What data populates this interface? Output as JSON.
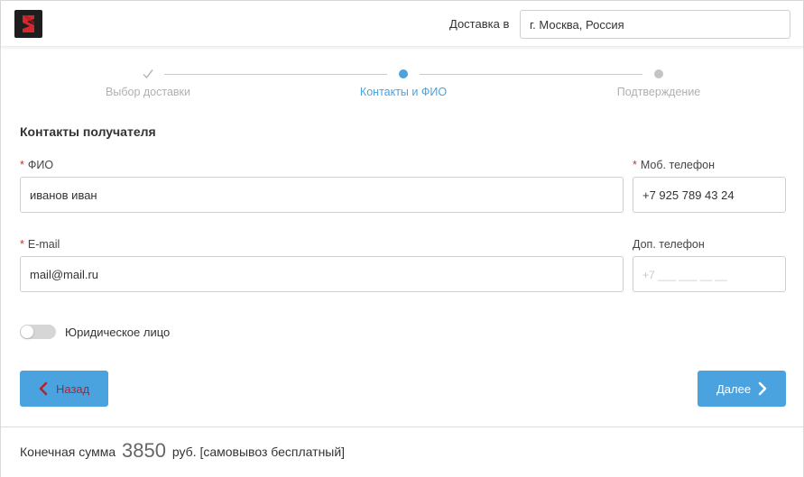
{
  "header": {
    "delivery_label": "Доставка в",
    "city_value": "г. Москва, Россия"
  },
  "steps": [
    {
      "label": "Выбор доставки",
      "state": "done"
    },
    {
      "label": "Контакты и ФИО",
      "state": "active"
    },
    {
      "label": "Подтверждение",
      "state": "pending"
    }
  ],
  "form": {
    "section_title": "Контакты получателя",
    "fio": {
      "label": "ФИО",
      "value": "иванов иван",
      "required": true
    },
    "mobile": {
      "label": "Моб. телефон",
      "value": "+7 925 789 43 24",
      "required": true
    },
    "email": {
      "label": "E-mail",
      "value": "mail@mail.ru",
      "required": true
    },
    "extra_phone": {
      "label": "Доп. телефон",
      "placeholder": "+7 ___ ___ __ __",
      "value": ""
    },
    "legal_entity": {
      "label": "Юридическое лицо",
      "checked": false
    }
  },
  "buttons": {
    "back_label": "Назад",
    "next_label": "Далее"
  },
  "footer": {
    "prefix": "Конечная сумма",
    "amount": "3850",
    "suffix": "руб. [самовывоз бесплатный]"
  },
  "colors": {
    "accent": "#4aa3df",
    "required": "#c0392b",
    "back_text": "#b4232c",
    "logo_bg": "#1e1e1e",
    "logo_mark": "#d7262e"
  }
}
